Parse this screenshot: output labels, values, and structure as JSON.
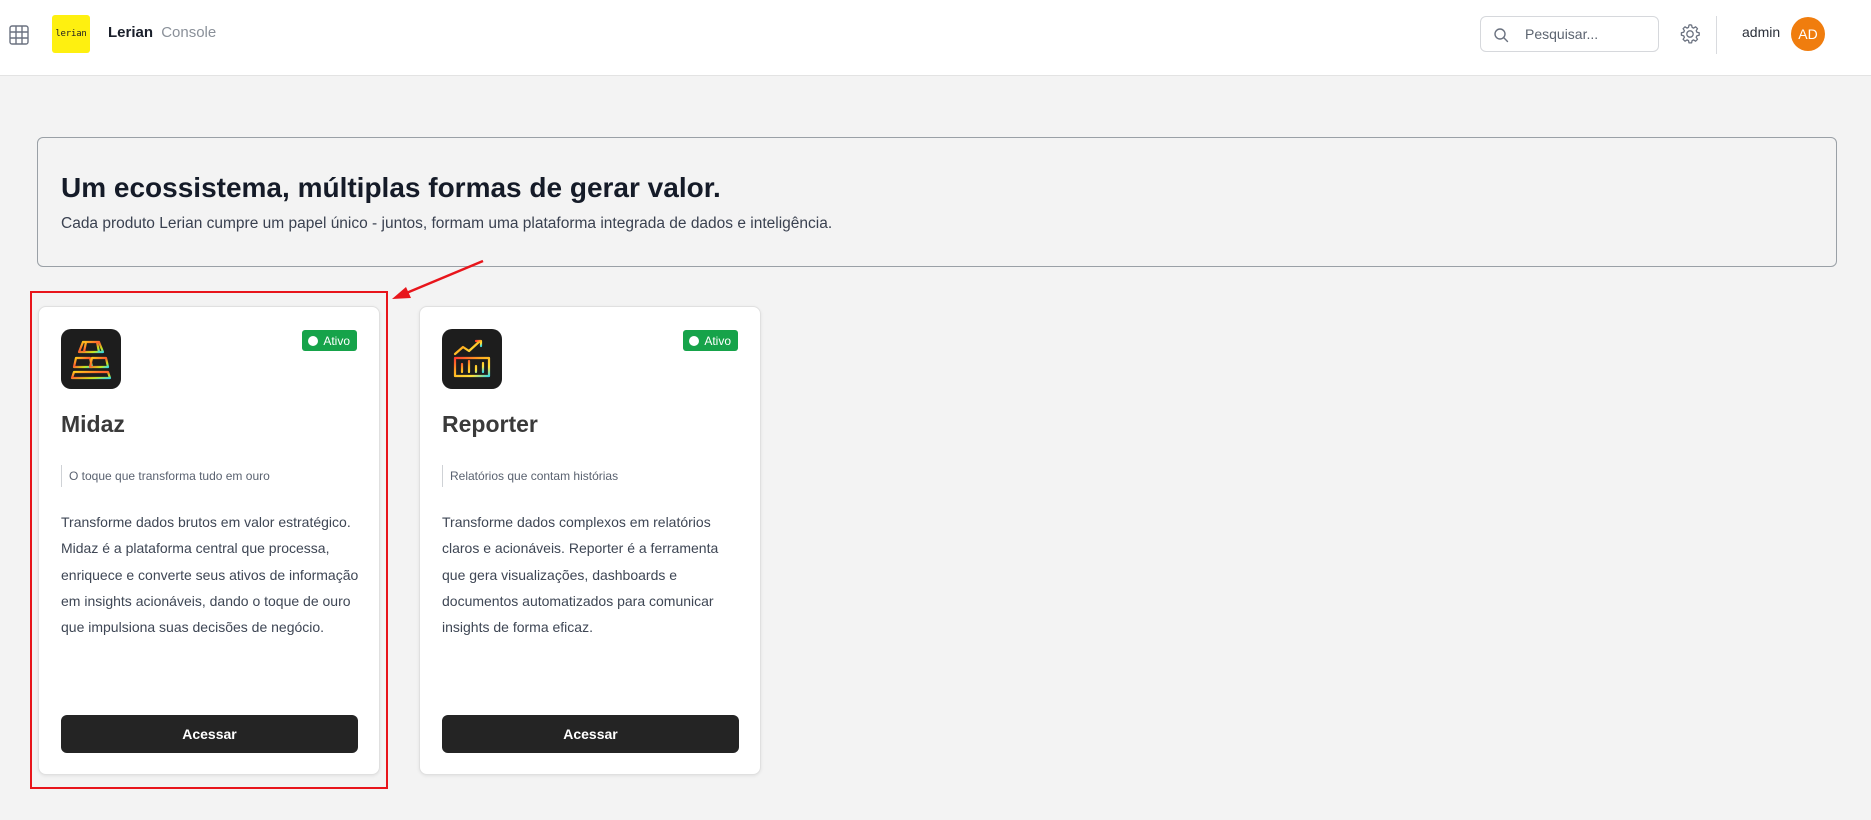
{
  "header": {
    "apps_icon": "grid-icon",
    "logo_text": "lerian",
    "brand_name": "Lerian",
    "brand_subtitle": "Console",
    "search": {
      "placeholder": "Pesquisar...",
      "value": "",
      "icon": "search-icon"
    },
    "settings_icon": "gear-icon",
    "username": "admin",
    "avatar_initials": "AD",
    "avatar_color": "#f07d0e"
  },
  "hero": {
    "title": "Um ecossistema, múltiplas formas de gerar valor.",
    "subtitle": "Cada produto Lerian cumpre um papel único - juntos, formam uma plataforma integrada de dados e inteligência."
  },
  "products": [
    {
      "name": "Midaz",
      "icon": "midaz-gold-bars-icon",
      "status": "Ativo",
      "tagline": "O toque que transforma tudo em ouro",
      "description": "Transforme dados brutos em valor estratégico. Midaz é a plataforma central que processa, enriquece e converte seus ativos de informação em insights acionáveis, dando o toque de ouro que impulsiona suas decisões de negócio.",
      "button_label": "Acessar"
    },
    {
      "name": "Reporter",
      "icon": "reporter-chart-icon",
      "status": "Ativo",
      "tagline": "Relatórios que contam histórias",
      "description": "Transforme dados complexos em relatórios claros e acionáveis. Reporter é a ferramenta que gera visualizações, dashboards e documentos automatizados para comunicar insights de forma eficaz.",
      "button_label": "Acessar"
    }
  ],
  "colors": {
    "status_active": "#16a34a",
    "highlight_annotation": "#e8151b",
    "logo_yellow": "#fef010",
    "button_dark": "#242424"
  }
}
